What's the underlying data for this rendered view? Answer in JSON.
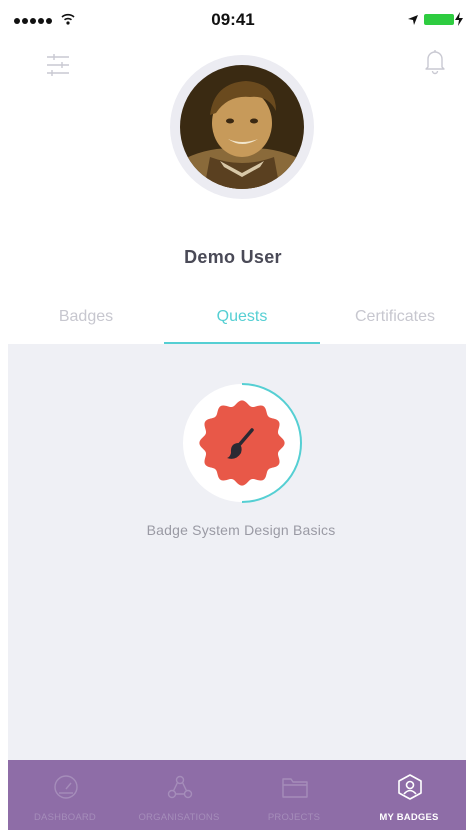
{
  "status_bar": {
    "time": "09:41"
  },
  "user": {
    "name": "Demo User"
  },
  "tabs": [
    {
      "label": "Badges",
      "active": false
    },
    {
      "label": "Quests",
      "active": true
    },
    {
      "label": "Certificates",
      "active": false
    }
  ],
  "quest": {
    "title": "Badge System Design Basics",
    "progress": 0.5,
    "badge_icon": "paintbrush-icon"
  },
  "bottom_nav": [
    {
      "label": "DASHBOARD",
      "icon": "gauge-icon",
      "active": false
    },
    {
      "label": "ORGANISATIONS",
      "icon": "network-icon",
      "active": false
    },
    {
      "label": "PROJECTS",
      "icon": "folder-icon",
      "active": false
    },
    {
      "label": "MY BADGES",
      "icon": "badge-icon",
      "active": true
    }
  ],
  "colors": {
    "accent": "#55cfd3",
    "nav_background": "#8e6da7",
    "badge_fill": "#e85848",
    "content_background": "#eff0f5"
  }
}
